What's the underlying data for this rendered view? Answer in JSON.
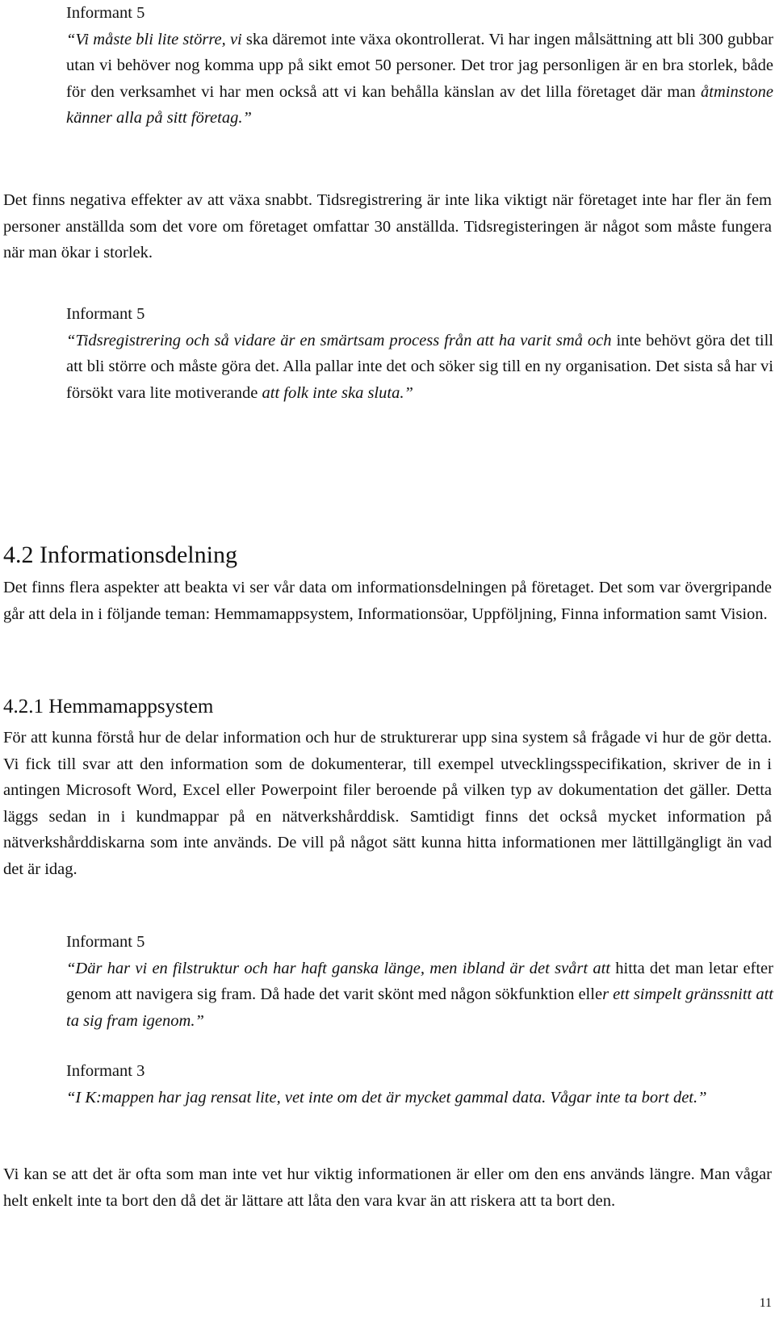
{
  "quote1": {
    "informant": "Informant 5",
    "italic_start": "“Vi måste bli lite större, vi",
    "normal_mid": " ska däremot inte växa okontrollerat. Vi har ingen målsättning att bli 300 gubbar utan vi behöver nog komma upp på sikt emot 50 personer. Det tror jag personligen är en bra storlek, både för den verksamhet vi har men också att vi kan behålla känslan av det lilla företaget där man ",
    "italic_end": "åtminstone känner alla på sitt företag.”"
  },
  "para1": "Det finns negativa effekter av att växa snabbt. Tidsregistrering är inte lika viktigt när företaget inte har fler än fem personer anställda som det vore om företaget omfattar 30 anställda. Tidsregisteringen är något som måste fungera när man ökar i storlek.",
  "quote2": {
    "informant": "Informant 5",
    "italic_start": "“Tidsregistrering och så vidare är en smärtsam process från att ha varit små och",
    "normal_mid": " inte behövt göra det till att bli större och måste göra det. Alla pallar inte det och söker sig till en ny organisation. Det sista så har vi försökt vara lite motiverande ",
    "italic_end": "att folk inte ska sluta.”"
  },
  "section_4_2": {
    "heading": "4.2 Informationsdelning",
    "body": "Det finns flera aspekter att beakta vi ser vår data om informationsdelningen på företaget. Det som var övergripande går att dela in i följande teman: Hemmamappsystem, Informationsöar, Uppföljning, Finna information samt Vision."
  },
  "section_4_2_1": {
    "heading": "4.2.1 Hemmamappsystem",
    "body": "För att kunna förstå hur de delar information och hur de strukturerar upp sina system så frågade vi hur de gör detta. Vi fick till svar att den information som de dokumenterar, till exempel utvecklingsspecifikation, skriver de in i antingen Microsoft Word, Excel eller Powerpoint filer beroende på vilken typ av dokumentation det gäller. Detta läggs sedan in i kundmappar på en nätverkshårddisk. Samtidigt finns det också mycket information på nätverkshårddiskarna som inte används. De vill på något sätt kunna hitta informationen mer lättillgängligt än vad det är idag."
  },
  "quote3": {
    "informant": "Informant 5",
    "italic_start": "“Där har vi en filstruktur och har haft ganska länge, men ibland är det svårt att",
    "normal_mid": " hitta det man letar efter genom att navigera sig fram. Då hade det varit skönt med någon sökfunktion elle",
    "italic_end": "r ett simpelt gränssnitt att ta sig fram igenom.”"
  },
  "quote4": {
    "informant": "Informant 3",
    "text": "“I K:mappen har jag rensat lite, vet inte om det är mycket gammal data. Vågar inte ta bort det.”"
  },
  "para_final": "Vi kan se att det är ofta som man inte vet hur viktig informationen är eller om den ens används längre. Man vågar helt enkelt inte ta bort den då det är lättare att låta den vara kvar än att riskera att ta bort den.",
  "page_number": "11"
}
